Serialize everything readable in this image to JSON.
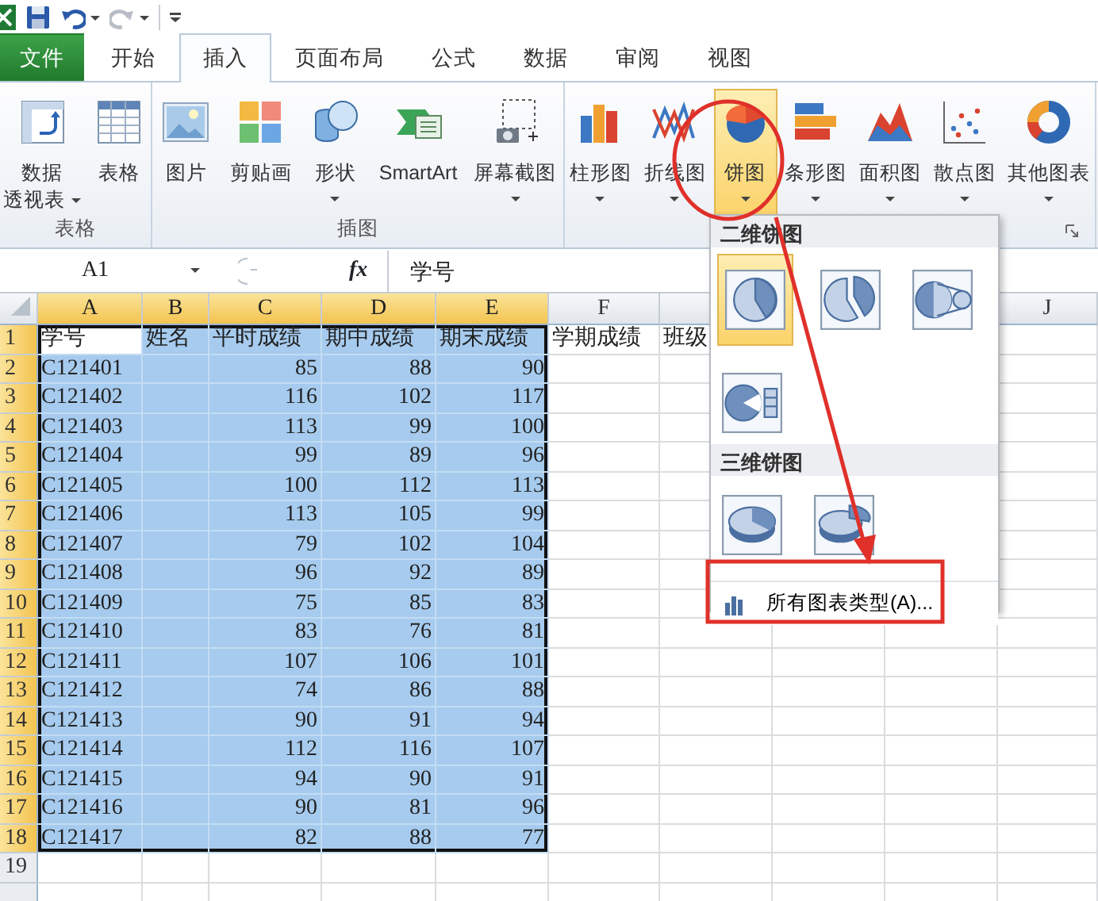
{
  "quick_access": {
    "buttons": [
      {
        "kind": "save",
        "enabled": true
      },
      {
        "kind": "undo",
        "enabled": true
      },
      {
        "kind": "redo",
        "enabled": false
      }
    ]
  },
  "tabs": [
    {
      "label": "文件",
      "kind": "file",
      "selected": false
    },
    {
      "label": "开始",
      "kind": "tab",
      "selected": false
    },
    {
      "label": "插入",
      "kind": "tab",
      "selected": true
    },
    {
      "label": "页面布局",
      "kind": "tab",
      "selected": false
    },
    {
      "label": "公式",
      "kind": "tab",
      "selected": false
    },
    {
      "label": "数据",
      "kind": "tab",
      "selected": false
    },
    {
      "label": "审阅",
      "kind": "tab",
      "selected": false
    },
    {
      "label": "视图",
      "kind": "tab",
      "selected": false
    }
  ],
  "ribbon": {
    "groups": [
      {
        "label": "表格",
        "buttons": [
          {
            "kind": "pivot",
            "lines": [
              "数据",
              "透视表"
            ],
            "dropdown": true,
            "pressed": false
          },
          {
            "kind": "table",
            "lines": [
              "表格"
            ],
            "pressed": false
          }
        ]
      },
      {
        "label": "插图",
        "buttons": [
          {
            "kind": "picture",
            "lines": [
              "图片"
            ],
            "pressed": false
          },
          {
            "kind": "clipart",
            "lines": [
              "剪贴画"
            ],
            "pressed": false
          },
          {
            "kind": "shapes",
            "lines": [
              "形状"
            ],
            "dropdown": true,
            "pressed": false
          },
          {
            "kind": "smartart",
            "lines": [
              "SmartArt"
            ],
            "pressed": false
          },
          {
            "kind": "screenshot",
            "lines": [
              "屏幕截图"
            ],
            "dropdown": true,
            "pressed": false
          }
        ]
      },
      {
        "launcher": true,
        "buttons": [
          {
            "kind": "column",
            "lines": [
              "柱形图"
            ],
            "dropdown": true,
            "pressed": false
          },
          {
            "kind": "line",
            "lines": [
              "折线图"
            ],
            "dropdown": true,
            "pressed": false
          },
          {
            "kind": "pie",
            "lines": [
              "饼图"
            ],
            "dropdown": true,
            "pressed": true
          },
          {
            "kind": "bar",
            "lines": [
              "条形图"
            ],
            "dropdown": true,
            "pressed": false
          },
          {
            "kind": "area",
            "lines": [
              "面积图"
            ],
            "dropdown": true,
            "pressed": false
          },
          {
            "kind": "scatter",
            "lines": [
              "散点图"
            ],
            "dropdown": true,
            "pressed": false
          },
          {
            "kind": "other",
            "lines": [
              "其他图表"
            ],
            "dropdown": true,
            "pressed": false
          }
        ]
      }
    ]
  },
  "formula_bar": {
    "name_box": "A1",
    "function_button": "fx",
    "formula": "学号"
  },
  "sheet": {
    "columns": [
      {
        "label": "A",
        "selected": true
      },
      {
        "label": "B",
        "selected": true
      },
      {
        "label": "C",
        "selected": true,
        "numeric": true
      },
      {
        "label": "D",
        "selected": true,
        "numeric": true
      },
      {
        "label": "E",
        "selected": true,
        "numeric": true
      },
      {
        "label": "F",
        "selected": false
      },
      {},
      {},
      {},
      {
        "label": "J",
        "selected": false
      }
    ],
    "rows": [
      {
        "header": "1",
        "kind": "title",
        "selected": true,
        "cells": [
          "学号",
          "姓名",
          "平时成绩",
          "期中成绩",
          "期末成绩",
          "学期成绩",
          "班级"
        ]
      },
      {
        "header": "2",
        "kind": "data",
        "selected": true,
        "cells": [
          "C121401",
          null,
          "85",
          "88",
          "90"
        ]
      },
      {
        "header": "3",
        "kind": "data",
        "selected": true,
        "cells": [
          "C121402",
          null,
          "116",
          "102",
          "117"
        ]
      },
      {
        "header": "4",
        "kind": "data",
        "selected": true,
        "cells": [
          "C121403",
          null,
          "113",
          "99",
          "100"
        ]
      },
      {
        "header": "5",
        "kind": "data",
        "selected": true,
        "cells": [
          "C121404",
          null,
          "99",
          "89",
          "96"
        ]
      },
      {
        "header": "6",
        "kind": "data",
        "selected": true,
        "cells": [
          "C121405",
          null,
          "100",
          "112",
          "113"
        ]
      },
      {
        "header": "7",
        "kind": "data",
        "selected": true,
        "cells": [
          "C121406",
          null,
          "113",
          "105",
          "99"
        ]
      },
      {
        "header": "8",
        "kind": "data",
        "selected": true,
        "cells": [
          "C121407",
          null,
          "79",
          "102",
          "104"
        ]
      },
      {
        "header": "9",
        "kind": "data",
        "selected": true,
        "cells": [
          "C121408",
          null,
          "96",
          "92",
          "89"
        ]
      },
      {
        "header": "10",
        "kind": "data",
        "selected": true,
        "cells": [
          "C121409",
          null,
          "75",
          "85",
          "83"
        ]
      },
      {
        "header": "11",
        "kind": "data",
        "selected": true,
        "cells": [
          "C121410",
          null,
          "83",
          "76",
          "81"
        ]
      },
      {
        "header": "12",
        "kind": "data",
        "selected": true,
        "cells": [
          "C121411",
          null,
          "107",
          "106",
          "101"
        ]
      },
      {
        "header": "13",
        "kind": "data",
        "selected": true,
        "cells": [
          "C121412",
          null,
          "74",
          "86",
          "88"
        ]
      },
      {
        "header": "14",
        "kind": "data",
        "selected": true,
        "cells": [
          "C121413",
          null,
          "90",
          "91",
          "94"
        ]
      },
      {
        "header": "15",
        "kind": "data",
        "selected": true,
        "cells": [
          "C121414",
          null,
          "112",
          "116",
          "107"
        ]
      },
      {
        "header": "16",
        "kind": "data",
        "selected": true,
        "cells": [
          "C121415",
          null,
          "94",
          "90",
          "91"
        ]
      },
      {
        "header": "17",
        "kind": "data",
        "selected": true,
        "cells": [
          "C121416",
          null,
          "90",
          "81",
          "96"
        ]
      },
      {
        "header": "18",
        "kind": "data",
        "selected": true,
        "cells": [
          "C121417",
          null,
          "82",
          "88",
          "77"
        ]
      },
      {
        "header": "19",
        "kind": "data",
        "selected": false
      },
      {
        "kind": "data",
        "selected": false
      }
    ]
  },
  "pie_menu": {
    "sections": [
      {
        "title": "二维饼图",
        "options": [
          {
            "kind": "pie",
            "selected": true
          },
          {
            "kind": "exploded",
            "selected": false
          },
          {
            "kind": "pie_of_pie",
            "selected": false
          },
          {
            "kind": "bar_of_pie",
            "selected": false
          }
        ]
      },
      {
        "title": "三维饼图",
        "options": [
          {
            "kind": "pie3d",
            "selected": false
          },
          {
            "kind": "exploded3d",
            "selected": false
          }
        ]
      }
    ],
    "footer": "所有图表类型(A)..."
  }
}
